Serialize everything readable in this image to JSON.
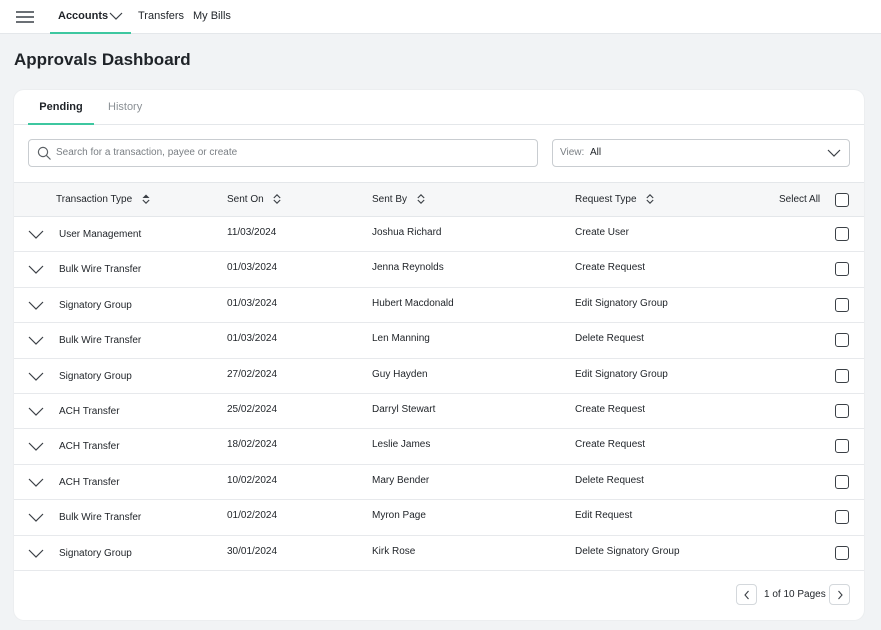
{
  "topbar": {
    "menu_icon": "hamburger-menu-icon",
    "nav": [
      {
        "label": "Accounts",
        "active": true,
        "has_dropdown": true
      },
      {
        "label": "Transfers",
        "active": false
      },
      {
        "label": "My Bills",
        "active": false
      }
    ]
  },
  "page": {
    "title": "Approvals Dashboard"
  },
  "tabs": [
    {
      "label": "Pending",
      "active": true
    },
    {
      "label": "History",
      "active": false
    }
  ],
  "search": {
    "placeholder": "Search for a transaction, payee or create",
    "icon": "search-icon"
  },
  "view_filter": {
    "label": "View:",
    "value": "All"
  },
  "table": {
    "columns": {
      "transaction_type": "Transaction Type",
      "sent_on": "Sent On",
      "sent_by": "Sent By",
      "request_type": "Request Type",
      "select_all": "Select All"
    },
    "rows": [
      {
        "transaction_type": "User Management",
        "sent_on": "11/03/2024",
        "sent_by": "Joshua Richard",
        "request_type": "Create User"
      },
      {
        "transaction_type": "Bulk Wire Transfer",
        "sent_on": "01/03/2024",
        "sent_by": "Jenna Reynolds",
        "request_type": "Create Request"
      },
      {
        "transaction_type": "Signatory Group",
        "sent_on": "01/03/2024",
        "sent_by": "Hubert Macdonald",
        "request_type": "Edit Signatory Group"
      },
      {
        "transaction_type": "Bulk Wire Transfer",
        "sent_on": "01/03/2024",
        "sent_by": "Len Manning",
        "request_type": "Delete Request"
      },
      {
        "transaction_type": "Signatory Group",
        "sent_on": "27/02/2024",
        "sent_by": "Guy Hayden",
        "request_type": "Edit Signatory Group"
      },
      {
        "transaction_type": "ACH Transfer",
        "sent_on": "25/02/2024",
        "sent_by": "Darryl Stewart",
        "request_type": "Create Request"
      },
      {
        "transaction_type": "ACH Transfer",
        "sent_on": "18/02/2024",
        "sent_by": "Leslie James",
        "request_type": "Create Request"
      },
      {
        "transaction_type": "ACH Transfer",
        "sent_on": "10/02/2024",
        "sent_by": "Mary Bender",
        "request_type": "Delete Request"
      },
      {
        "transaction_type": "Bulk Wire Transfer",
        "sent_on": "01/02/2024",
        "sent_by": "Myron Page",
        "request_type": "Edit Request"
      },
      {
        "transaction_type": "Signatory Group",
        "sent_on": "30/01/2024",
        "sent_by": "Kirk Rose",
        "request_type": "Delete Signatory Group"
      }
    ]
  },
  "pagination": {
    "text": "1 of 10 Pages"
  },
  "colors": {
    "accent": "#3ec7a0",
    "background": "#f1f3f5",
    "card": "#ffffff",
    "header_row": "#f6f7f8"
  }
}
